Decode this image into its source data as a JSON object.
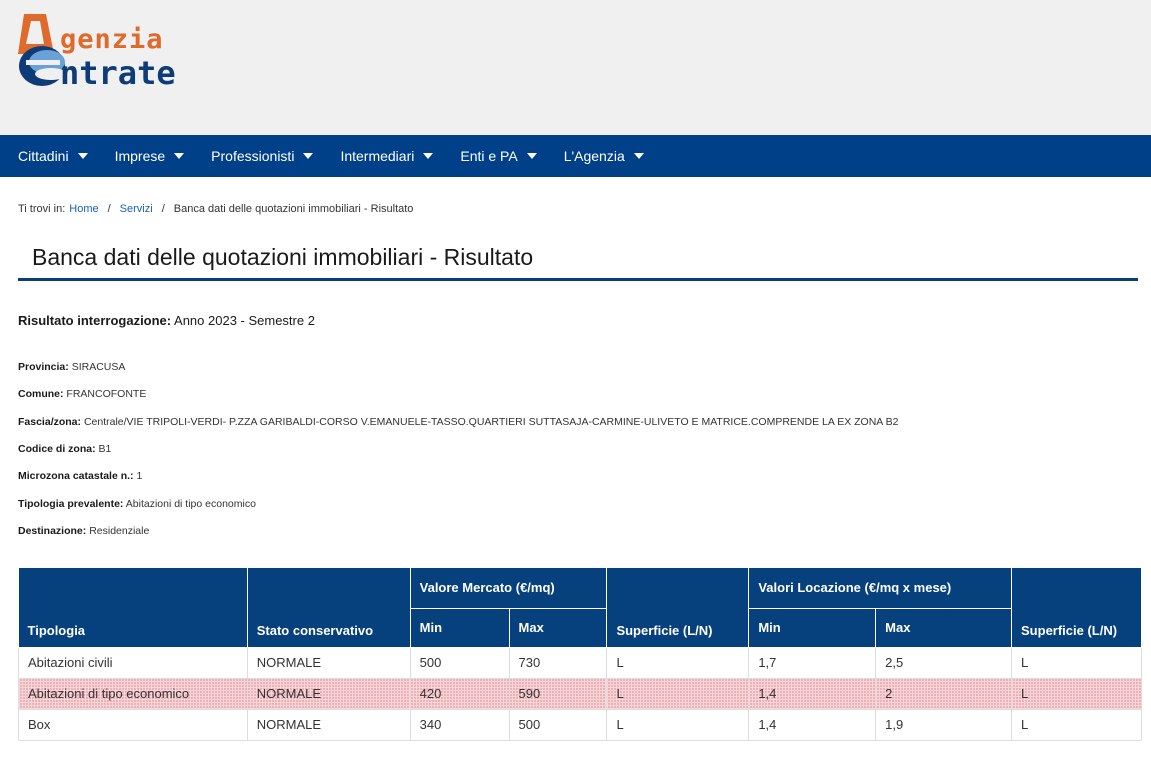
{
  "header": {
    "logo": {
      "line1": "genzia",
      "line2": "ntrate",
      "brand_color": "#e06a2b",
      "brand_color2": "#0d3c78"
    }
  },
  "nav": {
    "items": [
      {
        "label": "Cittadini"
      },
      {
        "label": "Imprese"
      },
      {
        "label": "Professionisti"
      },
      {
        "label": "Intermediari"
      },
      {
        "label": "Enti e PA"
      },
      {
        "label": "L'Agenzia"
      }
    ],
    "bg_color": "#004088"
  },
  "breadcrumb": {
    "prefix": "Ti trovi in:",
    "home": "Home",
    "servizi": "Servizi",
    "current": "Banca dati delle quotazioni immobiliari - Risultato",
    "separator": "/"
  },
  "page_title": "Banca dati delle quotazioni immobiliari - Risultato",
  "result": {
    "label": "Risultato interrogazione:",
    "value": "Anno 2023 - Semestre 2"
  },
  "info": {
    "provincia": {
      "label": "Provincia:",
      "value": "SIRACUSA"
    },
    "comune": {
      "label": "Comune:",
      "value": "FRANCOFONTE"
    },
    "fascia": {
      "label": "Fascia/zona:",
      "value": "Centrale/VIE TRIPOLI-VERDI- P.ZZA GARIBALDI-CORSO V.EMANUELE-TASSO.QUARTIERI SUTTASAJA-CARMINE-ULIVETO E MATRICE.COMPRENDE LA EX ZONA B2"
    },
    "codice": {
      "label": "Codice di zona:",
      "value": "B1"
    },
    "microzona": {
      "label": "Microzona catastale n.:",
      "value": "1"
    },
    "tipologia": {
      "label": "Tipologia prevalente:",
      "value": "Abitazioni di tipo economico"
    },
    "destinazione": {
      "label": "Destinazione:",
      "value": "Residenziale"
    }
  },
  "table": {
    "headers": {
      "tipologia": "Tipologia",
      "stato": "Stato conservativo",
      "valore_mercato": "Valore Mercato (€/mq)",
      "min": "Min",
      "max": "Max",
      "superficie": "Superficie (L/N)",
      "valori_locazione": "Valori Locazione (€/mq x mese)",
      "min2": "Min",
      "max2": "Max",
      "superficie2": "Superficie (L/N)"
    },
    "rows": [
      {
        "tipologia": "Abitazioni civili",
        "stato": "NORMALE",
        "vm_min": "500",
        "vm_max": "730",
        "sup": "L",
        "vl_min": "1,7",
        "vl_max": "2,5",
        "sup2": "L"
      },
      {
        "tipologia": "Abitazioni di tipo economico",
        "stato": "NORMALE",
        "vm_min": "420",
        "vm_max": "590",
        "sup": "L",
        "vl_min": "1,4",
        "vl_max": "2",
        "sup2": "L"
      },
      {
        "tipologia": "Box",
        "stato": "NORMALE",
        "vm_min": "340",
        "vm_max": "500",
        "sup": "L",
        "vl_min": "1,4",
        "vl_max": "1,9",
        "sup2": "L"
      }
    ],
    "header_color": "#06407d",
    "highlight_color": "#f6d6d9"
  }
}
